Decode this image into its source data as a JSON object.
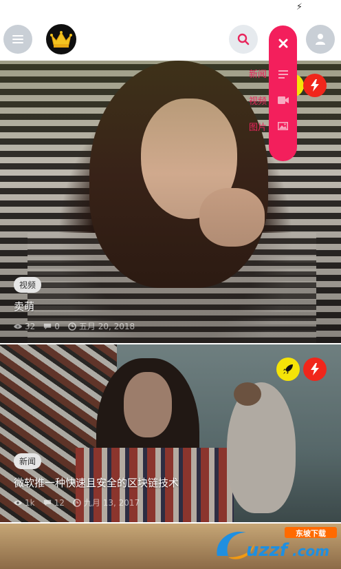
{
  "header": {
    "menu_icon": "hamburger-icon",
    "logo_icon": "crown-icon",
    "search_icon": "search-icon",
    "user_icon": "user-icon",
    "status_icon": "flash-icon"
  },
  "fab_menu": {
    "close_icon": "close-icon",
    "items": [
      {
        "label": "新闻",
        "icon": "text-lines-icon"
      },
      {
        "label": "视频",
        "icon": "video-camera-icon"
      },
      {
        "label": "图片",
        "icon": "image-icon"
      }
    ]
  },
  "posts": [
    {
      "tag": "视频",
      "title": "卖萌",
      "views": "32",
      "comments": "0",
      "date": "五月 20, 2018",
      "badges": [
        "flash"
      ]
    },
    {
      "tag": "新闻",
      "title": "微软推一种快速且安全的区块链技术",
      "views": "1k",
      "comments": "12",
      "date": "九月 13, 2017",
      "badges": [
        "rocket",
        "flash"
      ]
    }
  ],
  "watermark": {
    "brand": "uzzf.com",
    "sub": "东坡下载"
  },
  "colors": {
    "accent": "#f31f5c",
    "badge_red": "#f0261b",
    "badge_yellow": "#f5e408"
  }
}
